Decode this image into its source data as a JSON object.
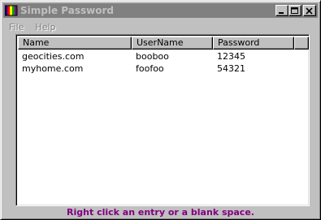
{
  "window": {
    "title": "Simple Password",
    "minimize_icon": "minimize-icon",
    "maximize_icon": "maximize-icon",
    "close_icon": "close-icon",
    "app_icon": "app-icon"
  },
  "menu": {
    "items": [
      {
        "label": "File"
      },
      {
        "label": "Help"
      }
    ]
  },
  "list": {
    "columns": [
      {
        "label": "Name"
      },
      {
        "label": "UserName"
      },
      {
        "label": "Password"
      },
      {
        "label": ""
      }
    ],
    "rows": [
      {
        "name": "geocities.com",
        "username": "booboo",
        "password": "12345"
      },
      {
        "name": "myhome.com",
        "username": "foofoo",
        "password": "54321"
      }
    ]
  },
  "status": {
    "text": "Right click an entry or a blank space."
  },
  "colors": {
    "titlebar_inactive": "#808080",
    "title_text": "#c0c0c0",
    "status_text": "#800080",
    "face": "#c0c0c0"
  }
}
